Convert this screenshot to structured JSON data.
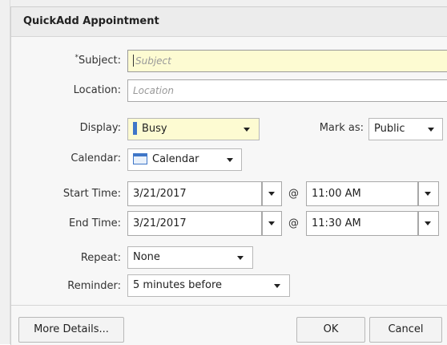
{
  "dialog": {
    "title": "QuickAdd Appointment"
  },
  "form": {
    "subject": {
      "required_mark": "*",
      "label": "Subject:",
      "placeholder": "Subject"
    },
    "location": {
      "label": "Location:",
      "placeholder": "Location"
    },
    "display": {
      "label": "Display:",
      "value": "Busy",
      "indicator_color": "#3f76c8"
    },
    "mark_as": {
      "label": "Mark as:",
      "value": "Public"
    },
    "calendar": {
      "label": "Calendar:",
      "value": "Calendar"
    },
    "start_time": {
      "label": "Start Time:",
      "date": "3/21/2017",
      "at": "@",
      "time": "11:00 AM"
    },
    "end_time": {
      "label": "End Time:",
      "date": "3/21/2017",
      "at": "@",
      "time": "11:30 AM"
    },
    "repeat": {
      "label": "Repeat:",
      "value": "None"
    },
    "reminder": {
      "label": "Reminder:",
      "value": "5 minutes before"
    }
  },
  "footer": {
    "more_details": "More Details...",
    "ok": "OK",
    "cancel": "Cancel"
  },
  "colors": {
    "highlight_field": "#fdfbd2",
    "accent": "#3f76c8"
  }
}
